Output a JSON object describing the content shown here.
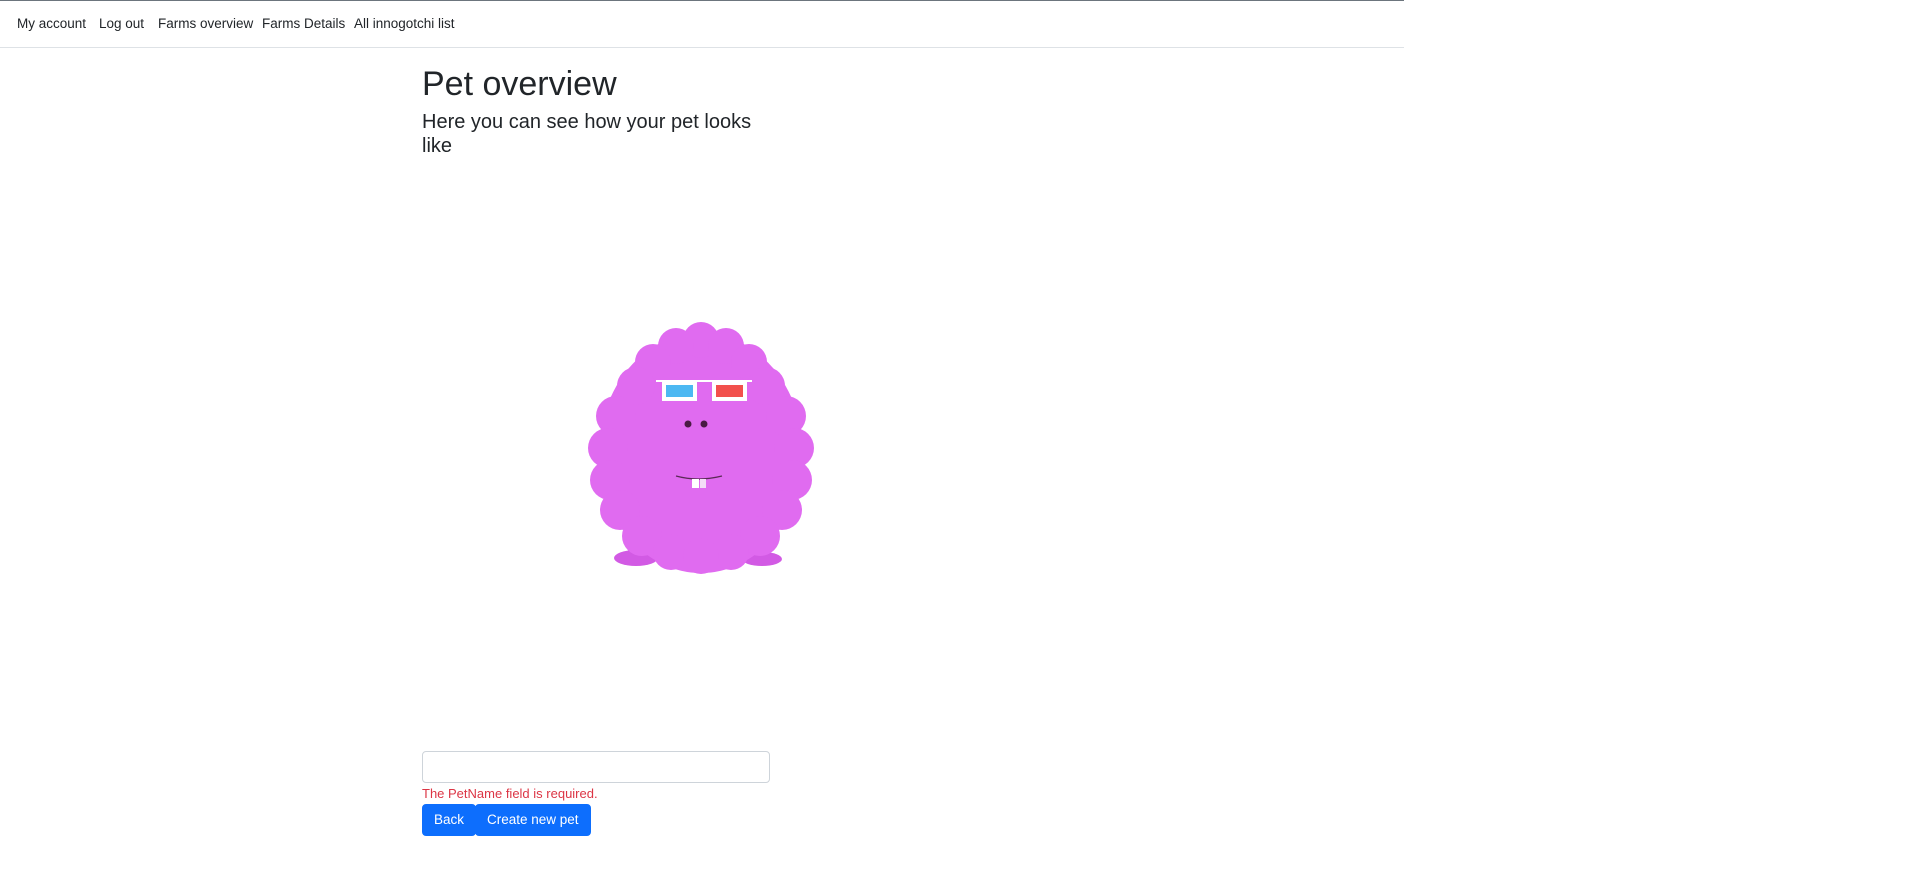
{
  "nav": {
    "items": [
      {
        "label": "My account"
      },
      {
        "label": "Log out"
      },
      {
        "label": "Farms overview"
      },
      {
        "label": "Farms Details"
      },
      {
        "label": "All innogotchi list"
      }
    ]
  },
  "main": {
    "title": "Pet overview",
    "subtitle": "Here you can see how your pet looks like"
  },
  "pet": {
    "body_color": "#e06bf0",
    "feet_color": "#d25ae4",
    "left_lens_color": "#4cb8f2",
    "right_lens_color": "#f2504c"
  },
  "form": {
    "pet_name_value": "",
    "error_message": "The PetName field is required.",
    "back_label": "Back",
    "create_label": "Create new pet"
  }
}
